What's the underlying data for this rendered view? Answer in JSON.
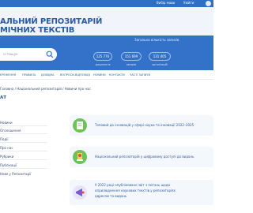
{
  "topbar": {
    "language": "Вибір мови",
    "user": "Увійти"
  },
  "header": {
    "title_line1": "АЛЬНИЙ РЕПОЗИТАРІЙ",
    "title_line2": "МІЧНИХ ТЕКСТІВ"
  },
  "search": {
    "placeholder": "ні пошук"
  },
  "stats": {
    "title": "Загальна кількість записів",
    "items": [
      {
        "value": "125 776",
        "label": "документів"
      },
      {
        "value": "151 699",
        "label": "авторів"
      },
      {
        "value": "131 405",
        "label": "організацій"
      }
    ]
  },
  "nav": {
    "items": [
      "ЕРЕЖЕННЯ",
      "ПРАВИЛА",
      "ДОВІДКА",
      "ВОПРОСИ-ВІДПОВІДІ",
      "НОВИНИ",
      "КОНТАКТИ",
      "ЧАСТІ ЗАПИТИ"
    ]
  },
  "breadcrumb": "Головна / Національний репозитарій / Новини про нас",
  "section_title": "АТ",
  "sidebar": {
    "items": [
      "Новини",
      "Оголошення",
      "Події",
      "Про нас",
      "Рубрики",
      "Публікації",
      "Нове у Репозитарії"
    ]
  },
  "news": [
    {
      "text": "Топовий до інновацій у сфері науки та інновації 2022–2025"
    },
    {
      "text": "Національний репозитарій у цифровому доступі до видань"
    },
    {
      "text_line1": "У 2022 році опубліковано звіт з питань щодо",
      "text_line2": "оприлюднення наукових текстів у репозитаріях",
      "text_line3": "адресам та видань"
    }
  ]
}
